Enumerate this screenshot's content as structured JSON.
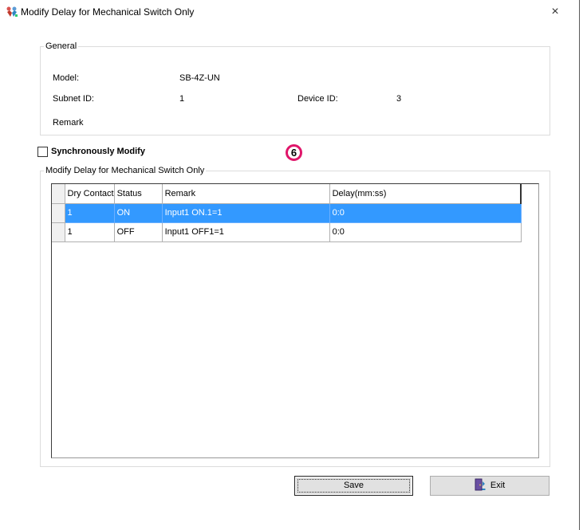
{
  "window": {
    "title": "Modify Delay for Mechanical Switch Only",
    "close_glyph": "×"
  },
  "general": {
    "legend": "General",
    "model_label": "Model:",
    "model_value": "SB-4Z-UN",
    "subnet_label": "Subnet ID:",
    "subnet_value": "1",
    "device_label": "Device ID:",
    "device_value": "3",
    "remark_label": "Remark"
  },
  "sync": {
    "label": "Synchronously Modify",
    "checked": false
  },
  "annotation": {
    "badge": "6"
  },
  "modify": {
    "legend": "Modify Delay for Mechanical Switch Only"
  },
  "table": {
    "columns": [
      "Dry Contact",
      "Status",
      "Remark",
      "Delay(mm:ss)"
    ],
    "rows": [
      {
        "dry_contact": "1",
        "status": "ON",
        "remark": "Input1 ON.1=1",
        "delay": "0:0",
        "selected": true
      },
      {
        "dry_contact": "1",
        "status": "OFF",
        "remark": "Input1 OFF1=1",
        "delay": "0:0",
        "selected": false
      }
    ]
  },
  "buttons": {
    "save_label": "Save",
    "exit_label": "Exit"
  },
  "colors": {
    "selection": "#3399ff",
    "badge_ring": "#e0166a"
  },
  "icons": {
    "title": "hands-app-icon",
    "exit": "exit-door-icon"
  }
}
